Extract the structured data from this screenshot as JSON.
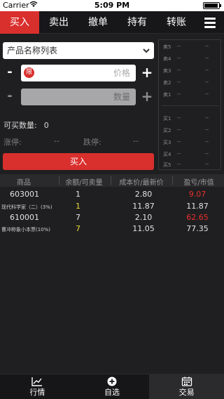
{
  "status_bar": {
    "carrier": "Carrier",
    "time": "5:09 PM"
  },
  "tabs": [
    {
      "label": "买入",
      "active": true
    },
    {
      "label": "卖出",
      "active": false
    },
    {
      "label": "撤单",
      "active": false
    },
    {
      "label": "持有",
      "active": false
    },
    {
      "label": "转账",
      "active": false
    }
  ],
  "form": {
    "product_placeholder": "产品名称列表",
    "price_placeholder": "价格",
    "qty_placeholder": "数量",
    "limit_badge": "限",
    "minus_label": "-",
    "plus_label": "+",
    "available_label": "可买数量:",
    "available_value": "0",
    "limit_up_label": "涨停:",
    "limit_up_value": "--",
    "limit_down_label": "跌停:",
    "limit_down_value": "--",
    "buy_button": "买入"
  },
  "order_book": {
    "asks": [
      {
        "label": "卖5",
        "price": "--",
        "volume": "--"
      },
      {
        "label": "卖4",
        "price": "--",
        "volume": "--"
      },
      {
        "label": "卖3",
        "price": "--",
        "volume": "--"
      },
      {
        "label": "卖2",
        "price": "--",
        "volume": "--"
      },
      {
        "label": "卖1",
        "price": "--",
        "volume": "--"
      }
    ],
    "bids": [
      {
        "label": "买1",
        "price": "--",
        "volume": "--"
      },
      {
        "label": "买2",
        "price": "--",
        "volume": "--"
      },
      {
        "label": "买3",
        "price": "--",
        "volume": "--"
      },
      {
        "label": "买4",
        "price": "--",
        "volume": "--"
      },
      {
        "label": "买5",
        "price": "--",
        "volume": "--"
      }
    ]
  },
  "positions": {
    "headers": [
      "商品",
      "余额/可卖量",
      "成本价/最新价",
      "盈亏/市值"
    ],
    "rows": [
      {
        "code": "603001",
        "name": "现代科学家（二）(3%)",
        "balance": "1",
        "available": "1",
        "cost": "2.80",
        "latest": "11.87",
        "pnl": "9.07",
        "market_value": "11.87"
      },
      {
        "code": "610001",
        "name": "曹冲称象小本票(10%)",
        "balance": "7",
        "available": "7",
        "cost": "2.10",
        "latest": "11.05",
        "pnl": "62.65",
        "market_value": "77.35"
      }
    ]
  },
  "bottom_nav": [
    {
      "label": "行情",
      "icon": "chart-line-icon",
      "active": false
    },
    {
      "label": "自选",
      "icon": "plus-circle-icon",
      "active": false
    },
    {
      "label": "交易",
      "icon": "calendar-icon",
      "active": true
    }
  ],
  "colors": {
    "accent": "#d9302d",
    "gain": "#e8302c",
    "highlight": "#e6d63a",
    "background": "#1f1f21"
  }
}
